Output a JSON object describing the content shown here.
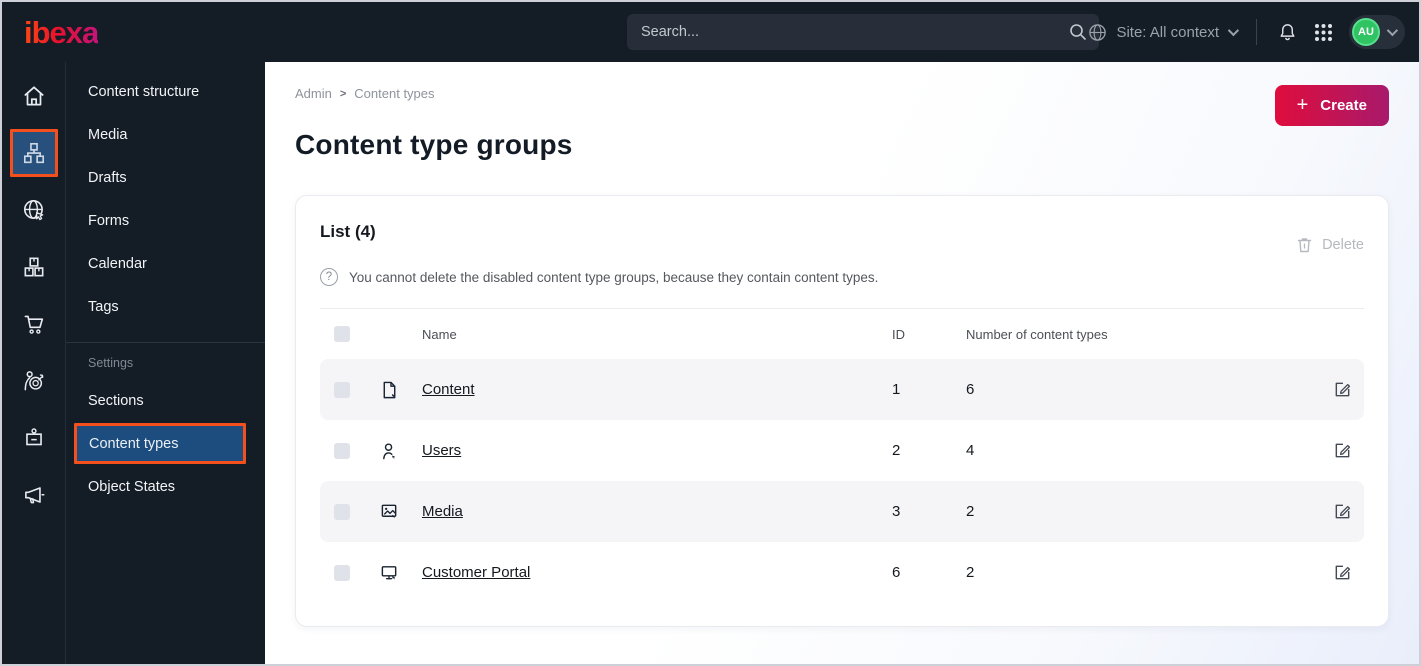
{
  "topbar": {
    "logo_text": "ibexa",
    "search_placeholder": "Search...",
    "site_label": "Site: All context",
    "avatar_initials": "AU"
  },
  "icons": {
    "rail": [
      "home-icon",
      "content-structure-icon",
      "site-globe-icon",
      "product-catalog-icon",
      "commerce-cart-icon",
      "personalization-icon",
      "admin-badge-icon",
      "campaign-icon"
    ],
    "help_glyph": "?",
    "plus_glyph": "+",
    "breadcrumb_sep": ">"
  },
  "menu": {
    "items": [
      "Content structure",
      "Media",
      "Drafts",
      "Forms",
      "Calendar",
      "Tags"
    ],
    "section_label": "Settings",
    "settings_items": [
      "Sections",
      "Content types",
      "Object States"
    ],
    "active_item": "Content types"
  },
  "main": {
    "breadcrumb": [
      "Admin",
      "Content types"
    ],
    "create_label": "Create",
    "title": "Content type groups",
    "card": {
      "title": "List (4)",
      "info": "You cannot delete the disabled content type groups, because they contain content types.",
      "delete_label": "Delete",
      "table": {
        "headers": {
          "name": "Name",
          "id": "ID",
          "count": "Number of content types"
        },
        "rows": [
          {
            "name": "Content",
            "id": "1",
            "count": "6"
          },
          {
            "name": "Users",
            "id": "2",
            "count": "4"
          },
          {
            "name": "Media",
            "id": "3",
            "count": "2"
          },
          {
            "name": "Customer Portal",
            "id": "6",
            "count": "2"
          }
        ]
      }
    }
  },
  "colors": {
    "topbar_bg": "#141c26",
    "active_blue": "#1d4c7e",
    "annotation_orange": "#f4501e",
    "create_gradient_start": "#df0d3d",
    "create_gradient_end": "#a81a6b",
    "avatar_green": "#2fc364",
    "row_shaded": "#f5f5f8"
  }
}
